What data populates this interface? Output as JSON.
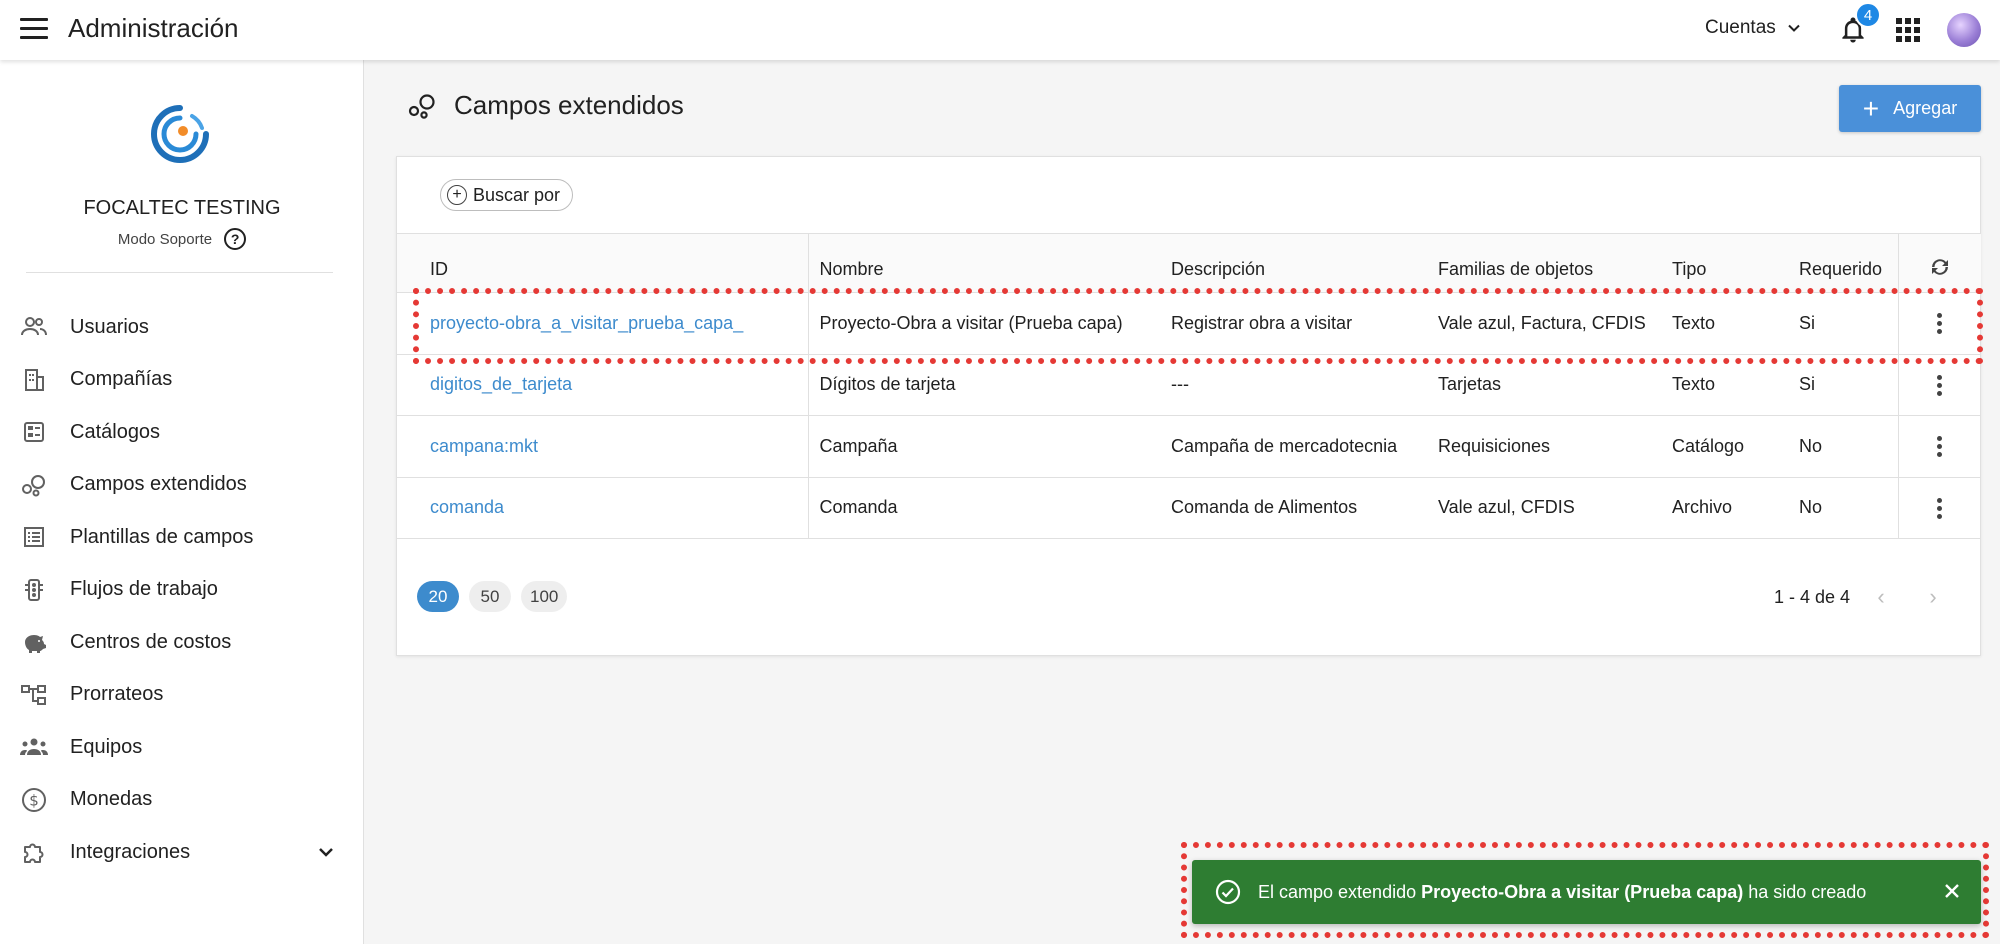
{
  "header": {
    "menu_icon": "menu-icon",
    "title": "Administración",
    "accounts_label": "Cuentas",
    "notifications_count": "4",
    "apps_icon": "apps-grid-icon"
  },
  "sidebar": {
    "org_name": "FOCALTEC TESTING",
    "mode": "Modo Soporte",
    "items": [
      {
        "label": "Usuarios",
        "icon": "users-icon"
      },
      {
        "label": "Compañías",
        "icon": "building-icon"
      },
      {
        "label": "Catálogos",
        "icon": "catalog-icon"
      },
      {
        "label": "Campos extendidos",
        "icon": "bubbles-icon"
      },
      {
        "label": "Plantillas de campos",
        "icon": "list-template-icon"
      },
      {
        "label": "Flujos de trabajo",
        "icon": "workflow-icon"
      },
      {
        "label": "Centros de costos",
        "icon": "piggy-bank-icon"
      },
      {
        "label": "Prorrateos",
        "icon": "tree-icon"
      },
      {
        "label": "Equipos",
        "icon": "teams-icon"
      },
      {
        "label": "Monedas",
        "icon": "dollar-icon"
      },
      {
        "label": "Integraciones",
        "icon": "puzzle-icon"
      }
    ]
  },
  "main": {
    "title": "Campos extendidos",
    "add_label": "Agregar",
    "search_label": "Buscar por",
    "columns": [
      "ID",
      "Nombre",
      "Descripción",
      "Familias de objetos",
      "Tipo",
      "Requerido"
    ],
    "rows": [
      {
        "id": "proyecto-obra_a_visitar_prueba_capa_",
        "nombre": "Proyecto-Obra a visitar (Prueba capa)",
        "descripcion": "Registrar obra a visitar",
        "familias": "Vale azul, Factura, CFDIS",
        "tipo": "Texto",
        "requerido": "Si"
      },
      {
        "id": "digitos_de_tarjeta",
        "nombre": "Dígitos de tarjeta",
        "descripcion": "---",
        "familias": "Tarjetas",
        "tipo": "Texto",
        "requerido": "Si"
      },
      {
        "id": "campana:mkt",
        "nombre": "Campaña",
        "descripcion": "Campaña de mercadotecnia",
        "familias": "Requisiciones",
        "tipo": "Catálogo",
        "requerido": "No"
      },
      {
        "id": "comanda",
        "nombre": "Comanda",
        "descripcion": "Comanda de Alimentos",
        "familias": "Vale azul, CFDIS",
        "tipo": "Archivo",
        "requerido": "No"
      }
    ],
    "page_sizes": [
      "20",
      "50",
      "100"
    ],
    "active_page_size": "20",
    "range": "1 - 4 de 4"
  },
  "toast": {
    "prefix": "El campo extendido ",
    "name": "Proyecto-Obra a visitar (Prueba capa)",
    "suffix": " ha sido creado"
  },
  "colors": {
    "accent": "#3d8bcd",
    "toast_bg": "#2e7d32",
    "highlight": "#e53935"
  }
}
